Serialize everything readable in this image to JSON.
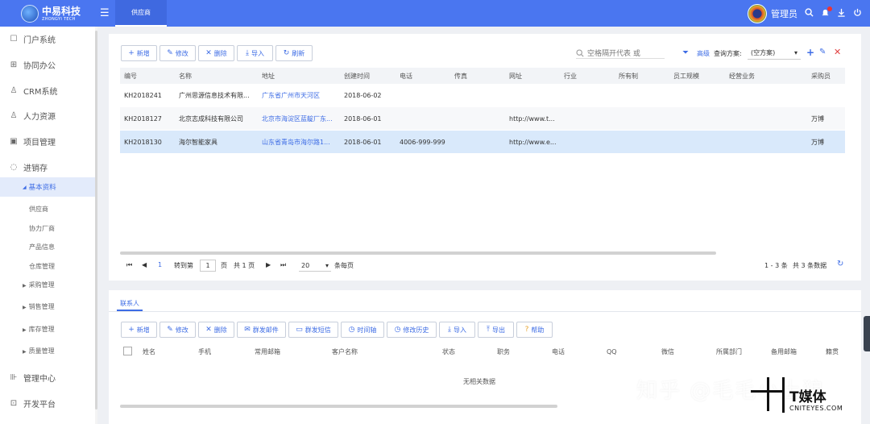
{
  "header": {
    "logo_cn": "中易科技",
    "logo_en": "ZHONGYI TECH",
    "menu_icon": "☰",
    "active_tab": "供应商",
    "admin_name": "管理员",
    "icons": [
      "search-icon",
      "bell-icon",
      "download-icon",
      "power-icon"
    ]
  },
  "sidebar": {
    "items": [
      {
        "label": "门户系统",
        "icon": "☐"
      },
      {
        "label": "协同办公",
        "icon": "⊞"
      },
      {
        "label": "CRM系统",
        "icon": "♙"
      },
      {
        "label": "人力资源",
        "icon": "♙"
      },
      {
        "label": "项目管理",
        "icon": "▣"
      },
      {
        "label": "进销存",
        "icon": "◌"
      }
    ],
    "active_group": "基本资料",
    "sub_items": [
      "供应商",
      "协力厂商",
      "产品信息",
      "仓库管理"
    ],
    "collapsed_groups": [
      "采购管理",
      "销售管理",
      "库存管理",
      "质量管理"
    ],
    "bottom_items": [
      {
        "label": "管理中心",
        "icon": "⊪"
      },
      {
        "label": "开发平台",
        "icon": "⊡"
      }
    ]
  },
  "toolbar": {
    "add": "新增",
    "edit": "修改",
    "delete": "删除",
    "import": "导入",
    "refresh": "刷新",
    "search_placeholder": "空格隔开代表 或",
    "advanced": "高级",
    "scheme_label": "查询方案:",
    "scheme_value": "(空方案)"
  },
  "table": {
    "columns": [
      "编号",
      "名称",
      "地址",
      "创建时间",
      "电话",
      "传真",
      "网址",
      "行业",
      "所有制",
      "员工规模",
      "经营业务",
      "采购员"
    ],
    "rows": [
      {
        "id": "KH2018241",
        "name": "广州思源信息技术有限...",
        "address": "广东省广州市天河区",
        "created": "2018-06-02",
        "phone": "",
        "fax": "",
        "url": "",
        "industry": "",
        "ownership": "",
        "staff": "",
        "business": "",
        "buyer": ""
      },
      {
        "id": "KH2018127",
        "name": "北京志成科技有限公司",
        "address": "北京市海淀区蓝靛厂东...",
        "created": "2018-06-01",
        "phone": "",
        "fax": "",
        "url": "http://www.t...",
        "industry": "",
        "ownership": "",
        "staff": "",
        "business": "",
        "buyer": "万博"
      },
      {
        "id": "KH2018130",
        "name": "海尔智能家具",
        "address": "山东省青岛市海尔路1...",
        "created": "2018-06-01",
        "phone": "4006-999-999",
        "fax": "",
        "url": "http://www.e...",
        "industry": "",
        "ownership": "",
        "staff": "",
        "business": "",
        "buyer": "万博"
      }
    ]
  },
  "pager": {
    "first": "⏮",
    "prev": "◀",
    "current_page": "1",
    "goto_label": "转到第",
    "page_input": "1",
    "page_unit": "页",
    "total_pages": "共 1 页",
    "next": "▶",
    "last": "⏭",
    "page_size": "20",
    "per_page": "条每页",
    "range": "1 - 3 条",
    "total": "共 3 条数据"
  },
  "contacts": {
    "tab": "联系人",
    "buttons": [
      "新增",
      "修改",
      "删除",
      "群发邮件",
      "群发短信",
      "时间轴",
      "修改历史",
      "导入",
      "导出",
      "帮助"
    ],
    "columns": [
      "姓名",
      "手机",
      "常用邮箱",
      "客户名称",
      "状态",
      "职务",
      "电话",
      "QQ",
      "微信",
      "所属部门",
      "备用邮箱",
      "籍贯"
    ],
    "empty": "无相关数据"
  },
  "watermark": {
    "text": "知乎 @毛毛小土狼",
    "brand_cn": "T媒体",
    "brand_en": "CNITEYES.COM"
  }
}
